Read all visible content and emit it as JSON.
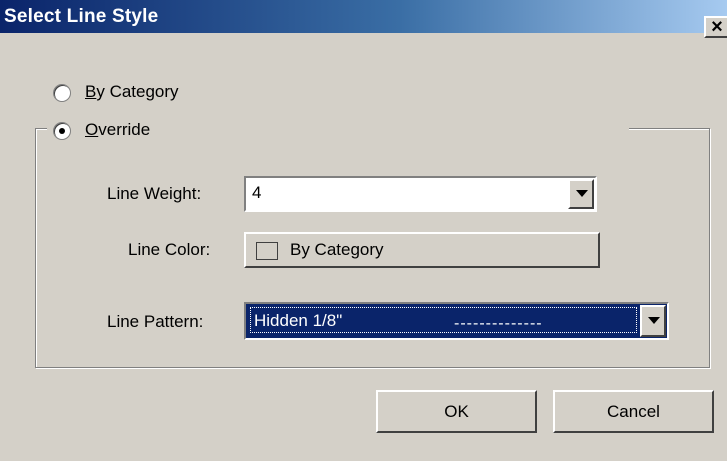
{
  "window": {
    "title": "Select Line Style",
    "close_glyph": "×"
  },
  "options": {
    "by_category": {
      "label": "By Category",
      "mnemonic": "B",
      "rest": "y Category",
      "selected": false
    },
    "override": {
      "label": "Override",
      "mnemonic": "O",
      "rest": "verride",
      "selected": true
    }
  },
  "fields": {
    "line_weight": {
      "label": "Line Weight:",
      "value": "4"
    },
    "line_color": {
      "label": "Line Color:",
      "value": "By Category"
    },
    "line_pattern": {
      "label": "Line Pattern:",
      "value": "Hidden 1/8\"",
      "preview": "--------------"
    }
  },
  "buttons": {
    "ok": "OK",
    "cancel": "Cancel"
  },
  "colors": {
    "title_start": "#0a246a",
    "selection": "#0a246a",
    "face": "#d4d0c8"
  }
}
